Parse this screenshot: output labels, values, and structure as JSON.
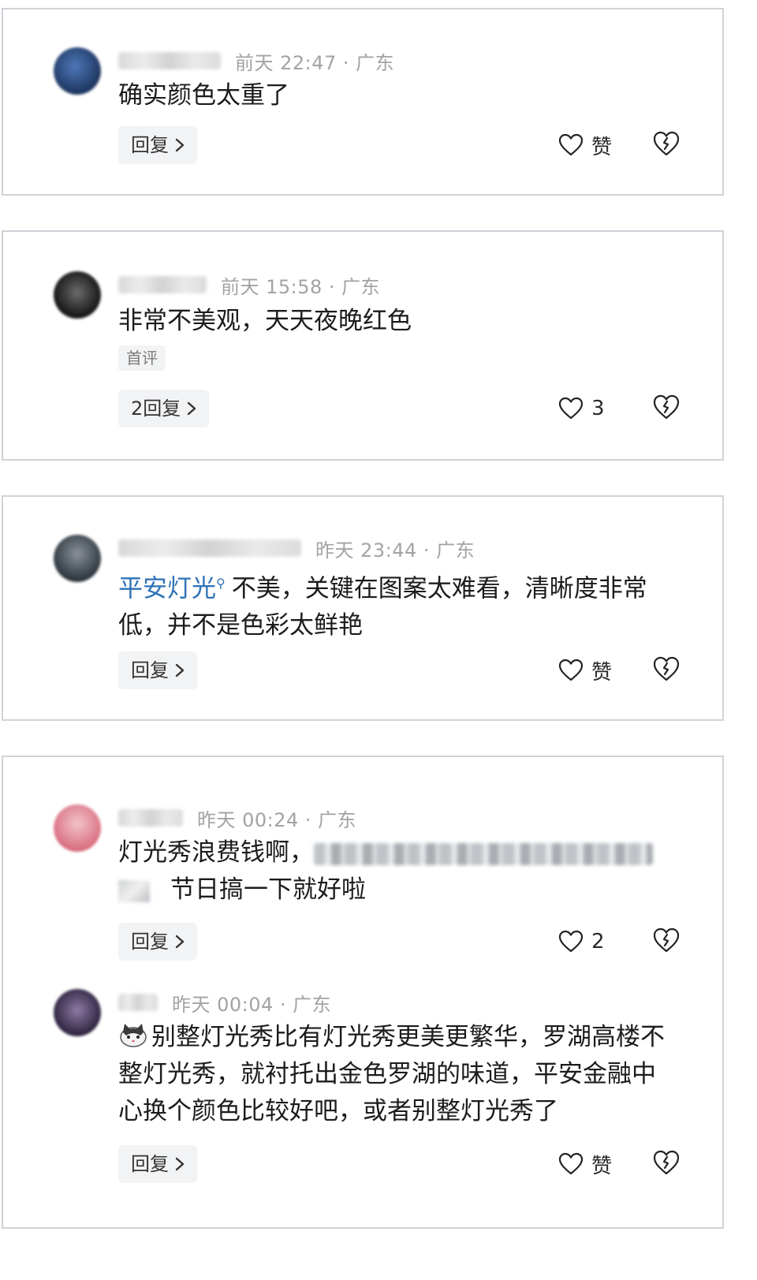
{
  "comments": [
    {
      "name": "用户昵称",
      "time": "前天 22:47 · 广东",
      "text": "确实颜色太重了",
      "reply_label": "回复",
      "like_label": "赞",
      "avatar_color": "#2e4f86"
    },
    {
      "name": "用户昵称",
      "time": "前天 15:58 · 广东",
      "text": "非常不美观，天天夜晚红色",
      "tag": "首评",
      "reply_label": "2回复",
      "like_label": "3",
      "avatar_color": "#2b2b2b"
    },
    {
      "name": "用户昵称",
      "time": "昨天 23:44 · 广东",
      "mention": "平安灯光",
      "text": "不美，关键在图案太难看，清晰度非常低，并不是色彩太鲜艳",
      "reply_label": "回复",
      "like_label": "赞",
      "avatar_color": "#4a5560"
    },
    {
      "name": "用户昵称",
      "time": "昨天 00:24 · 广东",
      "text_a": "灯光秀浪费钱啊，",
      "text_b": "节日搞一下就好啦",
      "reply_label": "回复",
      "like_label": "2",
      "avatar_color": "#e79aa6"
    },
    {
      "name": "用户昵称",
      "time": "昨天 00:04 · 广东",
      "text": "别整灯光秀比有灯光秀更美更繁华，罗湖高楼不整灯光秀，就衬托出金色罗湖的味道，平安金融中心换个颜色比较好吧，或者别整灯光秀了",
      "reply_label": "回复",
      "like_label": "赞",
      "avatar_color": "#5a4a6e"
    }
  ],
  "icons": {
    "like": "heart-outline-icon",
    "dislike": "broken-heart-icon",
    "reply_chevron": "chevron-right-icon"
  },
  "colors": {
    "card_border": "#cfd3d8",
    "meta_text": "#a3a3a3",
    "mention": "#2e73b8",
    "button_bg": "#f2f3f5"
  }
}
